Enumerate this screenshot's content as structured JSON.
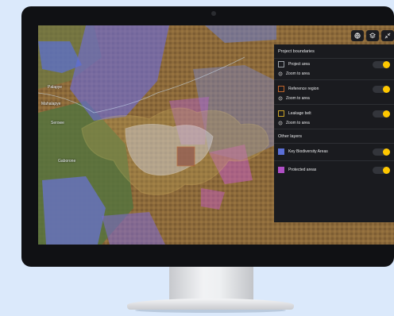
{
  "map": {
    "place_labels": [
      "Gaborone",
      "Mahalapye",
      "Serowe",
      "Palapye"
    ]
  },
  "toolbar": {
    "buttons": [
      {
        "icon": "globe-icon"
      },
      {
        "icon": "layers-icon"
      },
      {
        "icon": "collapse-icon"
      }
    ]
  },
  "panel": {
    "project_boundaries_title": "Project boundaries",
    "project_area": {
      "label": "Project area",
      "zoom_label": "Zoom to area",
      "swatch_color": "#9aa0a6",
      "enabled": true
    },
    "reference_region": {
      "label": "Reference region",
      "zoom_label": "Zoom to area",
      "swatch_color": "#c0642a",
      "enabled": true
    },
    "leakage_belt": {
      "label": "Leakage belt",
      "zoom_label": "Zoom to area",
      "swatch_color": "#c9a227",
      "enabled": true
    },
    "other_layers_title": "Other layers",
    "key_biodiversity": {
      "label": "Key Biodiversity Areas",
      "swatch_color": "#5b6fd6",
      "enabled": true
    },
    "protected_areas": {
      "label": "Protected areas",
      "swatch_color": "#b04fc4",
      "enabled": true
    }
  },
  "colors": {
    "toggle_on": "#ffc800",
    "panel_bg": "#1a1b1f",
    "page_bg": "#dbe9fb"
  }
}
